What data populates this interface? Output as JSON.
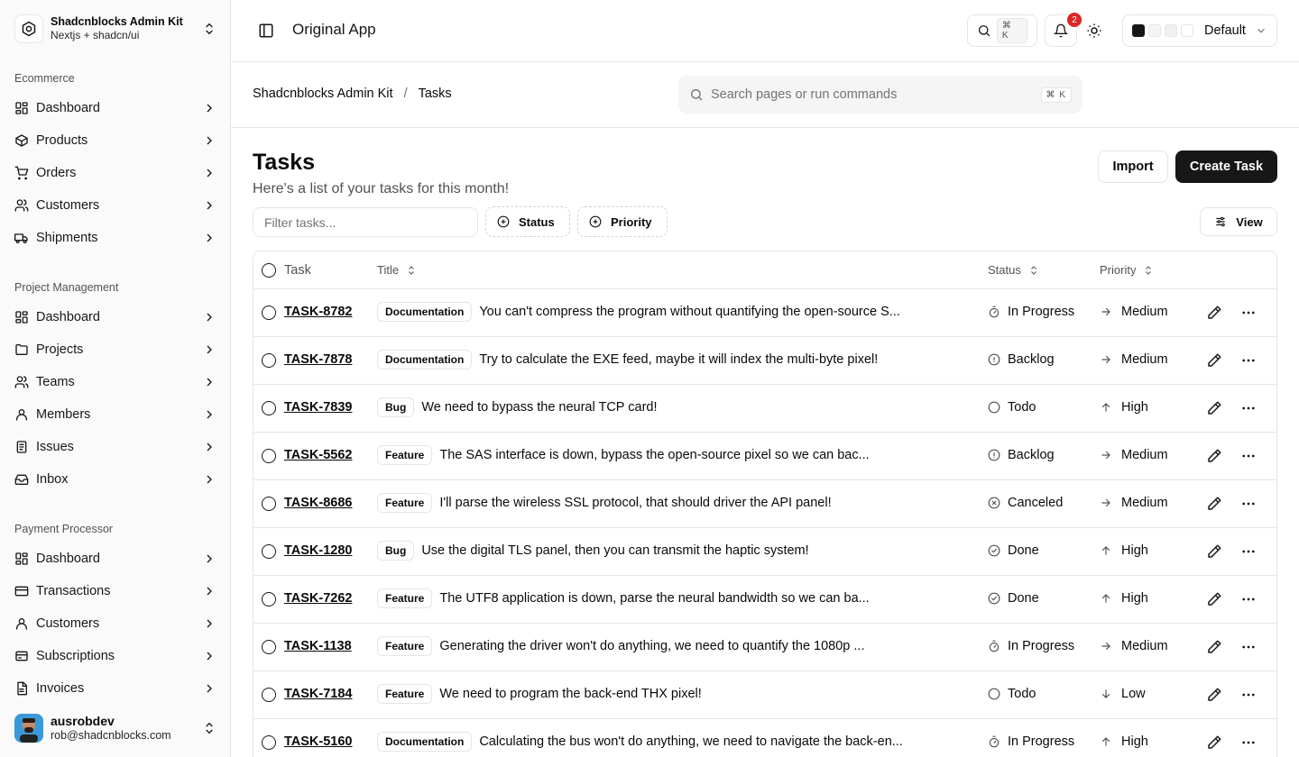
{
  "brand": {
    "name": "Shadcnblocks Admin Kit",
    "subtitle": "Nextjs + shadcn/ui"
  },
  "sidebar": {
    "groups": [
      {
        "label": "Ecommerce",
        "items": [
          {
            "label": "Dashboard",
            "icon": "dashboard-icon"
          },
          {
            "label": "Products",
            "icon": "box-icon"
          },
          {
            "label": "Orders",
            "icon": "cart-icon"
          },
          {
            "label": "Customers",
            "icon": "users-icon"
          },
          {
            "label": "Shipments",
            "icon": "truck-icon"
          }
        ]
      },
      {
        "label": "Project Management",
        "items": [
          {
            "label": "Dashboard",
            "icon": "dashboard-icon"
          },
          {
            "label": "Projects",
            "icon": "folder-icon"
          },
          {
            "label": "Teams",
            "icon": "users-icon"
          },
          {
            "label": "Members",
            "icon": "user-icon"
          },
          {
            "label": "Issues",
            "icon": "clipboard-icon"
          },
          {
            "label": "Inbox",
            "icon": "inbox-icon"
          }
        ]
      },
      {
        "label": "Payment Processor",
        "items": [
          {
            "label": "Dashboard",
            "icon": "dashboard-icon"
          },
          {
            "label": "Transactions",
            "icon": "credit-card-icon"
          },
          {
            "label": "Customers",
            "icon": "user-icon"
          },
          {
            "label": "Subscriptions",
            "icon": "repeat-icon"
          },
          {
            "label": "Invoices",
            "icon": "invoice-icon"
          }
        ]
      }
    ]
  },
  "user": {
    "name": "ausrobdev",
    "email": "rob@shadcnblocks.com"
  },
  "topbar": {
    "app_title": "Original App",
    "search_kbd": "⌘ K",
    "notification_count": "2",
    "theme_label": "Default",
    "theme_swatches": [
      "#171717",
      "#f5f5f5",
      "#f0f0f0",
      "#ffffff"
    ]
  },
  "breadcrumb": {
    "root": "Shadcnblocks Admin Kit",
    "separator": "/",
    "current": "Tasks"
  },
  "command_search": {
    "placeholder": "Search pages or run commands",
    "kbd": "⌘ K"
  },
  "page": {
    "title": "Tasks",
    "subtitle": "Here's a list of your tasks for this month!",
    "import_label": "Import",
    "create_label": "Create Task"
  },
  "toolbar": {
    "filter_placeholder": "Filter tasks...",
    "status_filter": "Status",
    "priority_filter": "Priority",
    "view_label": "View"
  },
  "table": {
    "headers": {
      "task": "Task",
      "title": "Title",
      "status": "Status",
      "priority": "Priority"
    },
    "rows": [
      {
        "id": "TASK-8782",
        "label": "Documentation",
        "title": "You can't compress the program without quantifying the open-source S...",
        "status": "In Progress",
        "status_icon": "timer-icon",
        "priority": "Medium",
        "priority_icon": "arrow-right-icon"
      },
      {
        "id": "TASK-7878",
        "label": "Documentation",
        "title": "Try to calculate the EXE feed, maybe it will index the multi-byte pixel!",
        "status": "Backlog",
        "status_icon": "help-circle-icon",
        "priority": "Medium",
        "priority_icon": "arrow-right-icon"
      },
      {
        "id": "TASK-7839",
        "label": "Bug",
        "title": "We need to bypass the neural TCP card!",
        "status": "Todo",
        "status_icon": "circle-icon",
        "priority": "High",
        "priority_icon": "arrow-up-icon"
      },
      {
        "id": "TASK-5562",
        "label": "Feature",
        "title": "The SAS interface is down, bypass the open-source pixel so we can bac...",
        "status": "Backlog",
        "status_icon": "help-circle-icon",
        "priority": "Medium",
        "priority_icon": "arrow-right-icon"
      },
      {
        "id": "TASK-8686",
        "label": "Feature",
        "title": "I'll parse the wireless SSL protocol, that should driver the API panel!",
        "status": "Canceled",
        "status_icon": "x-circle-icon",
        "priority": "Medium",
        "priority_icon": "arrow-right-icon"
      },
      {
        "id": "TASK-1280",
        "label": "Bug",
        "title": "Use the digital TLS panel, then you can transmit the haptic system!",
        "status": "Done",
        "status_icon": "check-circle-icon",
        "priority": "High",
        "priority_icon": "arrow-up-icon"
      },
      {
        "id": "TASK-7262",
        "label": "Feature",
        "title": "The UTF8 application is down, parse the neural bandwidth so we can ba...",
        "status": "Done",
        "status_icon": "check-circle-icon",
        "priority": "High",
        "priority_icon": "arrow-up-icon"
      },
      {
        "id": "TASK-1138",
        "label": "Feature",
        "title": "Generating the driver won't do anything, we need to quantify the 1080p ...",
        "status": "In Progress",
        "status_icon": "timer-icon",
        "priority": "Medium",
        "priority_icon": "arrow-right-icon"
      },
      {
        "id": "TASK-7184",
        "label": "Feature",
        "title": "We need to program the back-end THX pixel!",
        "status": "Todo",
        "status_icon": "circle-icon",
        "priority": "Low",
        "priority_icon": "arrow-down-icon"
      },
      {
        "id": "TASK-5160",
        "label": "Documentation",
        "title": "Calculating the bus won't do anything, we need to navigate the back-en...",
        "status": "In Progress",
        "status_icon": "timer-icon",
        "priority": "High",
        "priority_icon": "arrow-up-icon"
      }
    ]
  }
}
